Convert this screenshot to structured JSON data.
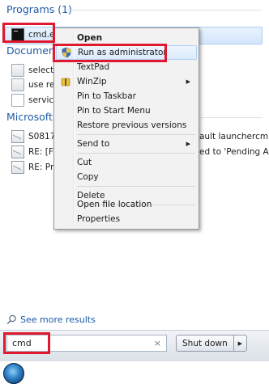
{
  "groups": {
    "programs": {
      "label": "Programs (1)"
    },
    "documents": {
      "label": "Document"
    },
    "outlook": {
      "label": "Microsoft C"
    }
  },
  "programs_items": [
    {
      "label": "cmd.exe",
      "icon": "cmd-icon"
    }
  ],
  "document_items": [
    {
      "label": "selectal",
      "icon": "document-icon"
    },
    {
      "label": "use rec",
      "icon": "document-icon"
    },
    {
      "label": "services",
      "icon": "text-file-icon"
    }
  ],
  "outlook_items": [
    {
      "label": "S08178",
      "trailing": "ault launchercm..."
    },
    {
      "label": "RE: [Fus",
      "trailing": "ed to 'Pending A..."
    },
    {
      "label": "RE: Prol",
      "trailing": ""
    }
  ],
  "context_menu": {
    "items": [
      {
        "label": "Open",
        "bold": true
      },
      {
        "label": "Run as administrator",
        "highlighted": true,
        "icon": "uac-shield-icon"
      },
      {
        "label": "TextPad"
      },
      {
        "label": "WinZip",
        "submenu": true,
        "icon": "winzip-icon"
      },
      {
        "label": "Pin to Taskbar"
      },
      {
        "label": "Pin to Start Menu"
      },
      {
        "label": "Restore previous versions"
      },
      {
        "label": "Send to",
        "submenu": true
      },
      {
        "label": "Cut"
      },
      {
        "label": "Copy"
      },
      {
        "label": "Delete"
      },
      {
        "label": "Open file location"
      },
      {
        "label": "Properties"
      }
    ]
  },
  "see_more": {
    "label": "See more results"
  },
  "search": {
    "value": "cmd",
    "clear_glyph": "×"
  },
  "shutdown": {
    "label": "Shut down",
    "arrow_glyph": "▶"
  },
  "submenu_arrow_glyph": "▶",
  "colors": {
    "header_blue": "#1e5aa8",
    "annotation_red": "#e0192f",
    "selection_bg": "#d3e6fb"
  }
}
